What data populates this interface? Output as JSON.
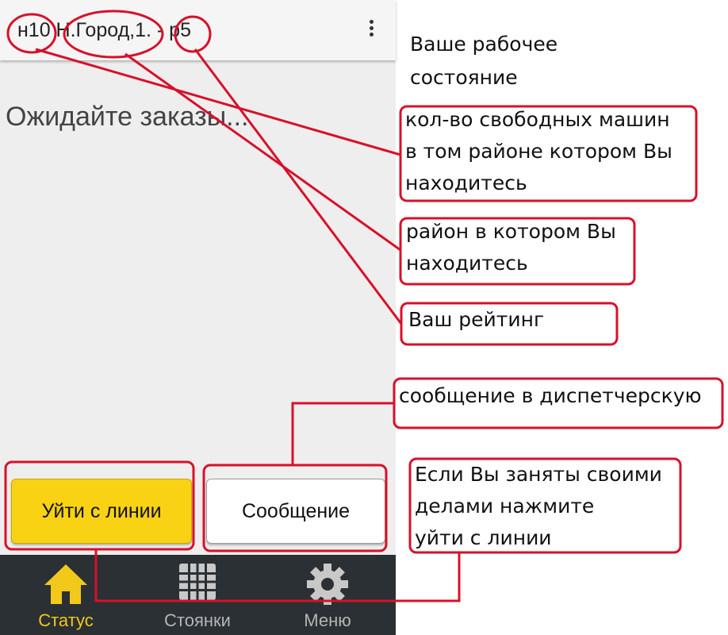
{
  "appbar": {
    "title": "н10 Н.Город,1. - р5",
    "menu_icon": "more-vert-icon"
  },
  "main": {
    "status_text": "Ожидайте заказы..."
  },
  "buttons": {
    "leave_label": "Уйти с линии",
    "message_label": "Сообщение"
  },
  "bottom_nav": {
    "items": [
      {
        "label": "Статус",
        "icon": "home-icon",
        "active": true
      },
      {
        "label": "Стоянки",
        "icon": "grid-icon",
        "active": false
      },
      {
        "label": "Меню",
        "icon": "gear-icon",
        "active": false
      }
    ]
  },
  "annotations": {
    "work_state": [
      "Ваше рабочее",
      "состояние"
    ],
    "free_cars": [
      "кол-во свободных машин",
      "в том районе котором Вы",
      "находитесь"
    ],
    "district": [
      "район в котором Вы",
      "находитесь"
    ],
    "rating": [
      "Ваш рейтинг"
    ],
    "message": [
      "сообщение в диспетчерскую"
    ],
    "leave": [
      "Если Вы заняты своими",
      "делами нажмите",
      "уйти с линии"
    ]
  },
  "colors": {
    "accent_yellow": "#f9d214",
    "nav_background": "#2a3034",
    "nav_active": "#f2c81a",
    "annotation_red": "#d8102a"
  }
}
